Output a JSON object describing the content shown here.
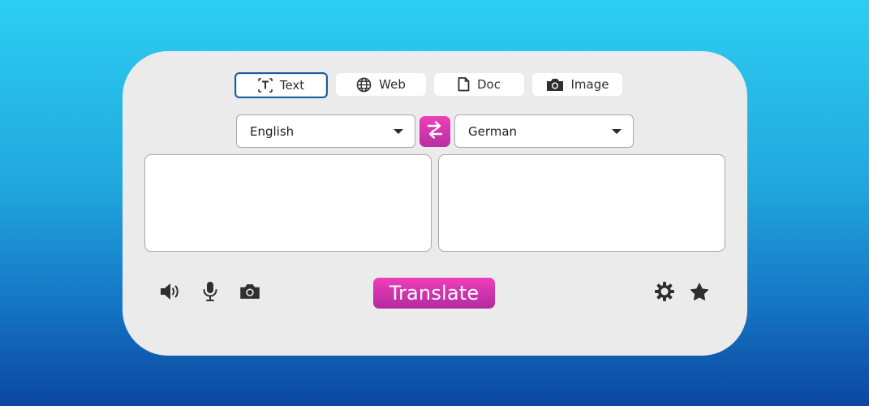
{
  "tabs": [
    {
      "label": "Text",
      "icon": "text-icon",
      "active": true
    },
    {
      "label": "Web",
      "icon": "globe-icon",
      "active": false
    },
    {
      "label": "Doc",
      "icon": "document-icon",
      "active": false
    },
    {
      "label": "Image",
      "icon": "camera-icon",
      "active": false
    }
  ],
  "languages": {
    "source": "English",
    "target": "German"
  },
  "input": {
    "source_value": "",
    "target_value": ""
  },
  "actions": {
    "translate_label": "Translate"
  },
  "colors": {
    "accent": "#e33ab3",
    "active_tab_border": "#1f5c9a",
    "card": "#ebebeb"
  }
}
